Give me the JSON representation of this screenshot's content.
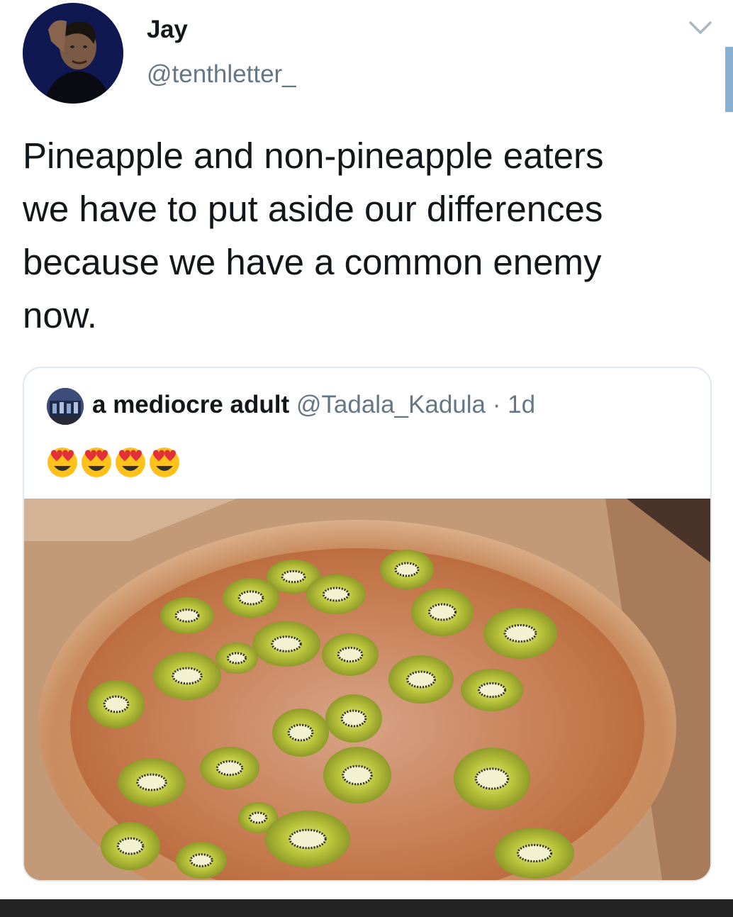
{
  "author": {
    "display_name": "Jay",
    "handle": "@tenthletter_"
  },
  "tweet": {
    "text_lines": [
      "Pineapple and non-pineapple eaters",
      "we have to put aside our differences",
      "because we have a common enemy",
      "now."
    ]
  },
  "quoted_tweet": {
    "display_name": "a mediocre adult",
    "handle": "@Tadala_Kadula",
    "separator": "·",
    "time": "1d",
    "emojis": [
      "heart-eyes-emoji",
      "heart-eyes-emoji",
      "heart-eyes-emoji",
      "heart-eyes-emoji"
    ]
  },
  "icons": {
    "menu": "chevron-down-icon"
  },
  "colors": {
    "text_primary": "#14171a",
    "text_secondary": "#657786",
    "border": "#e1e8ed",
    "scroll_indicator": "#8ab0d4"
  }
}
